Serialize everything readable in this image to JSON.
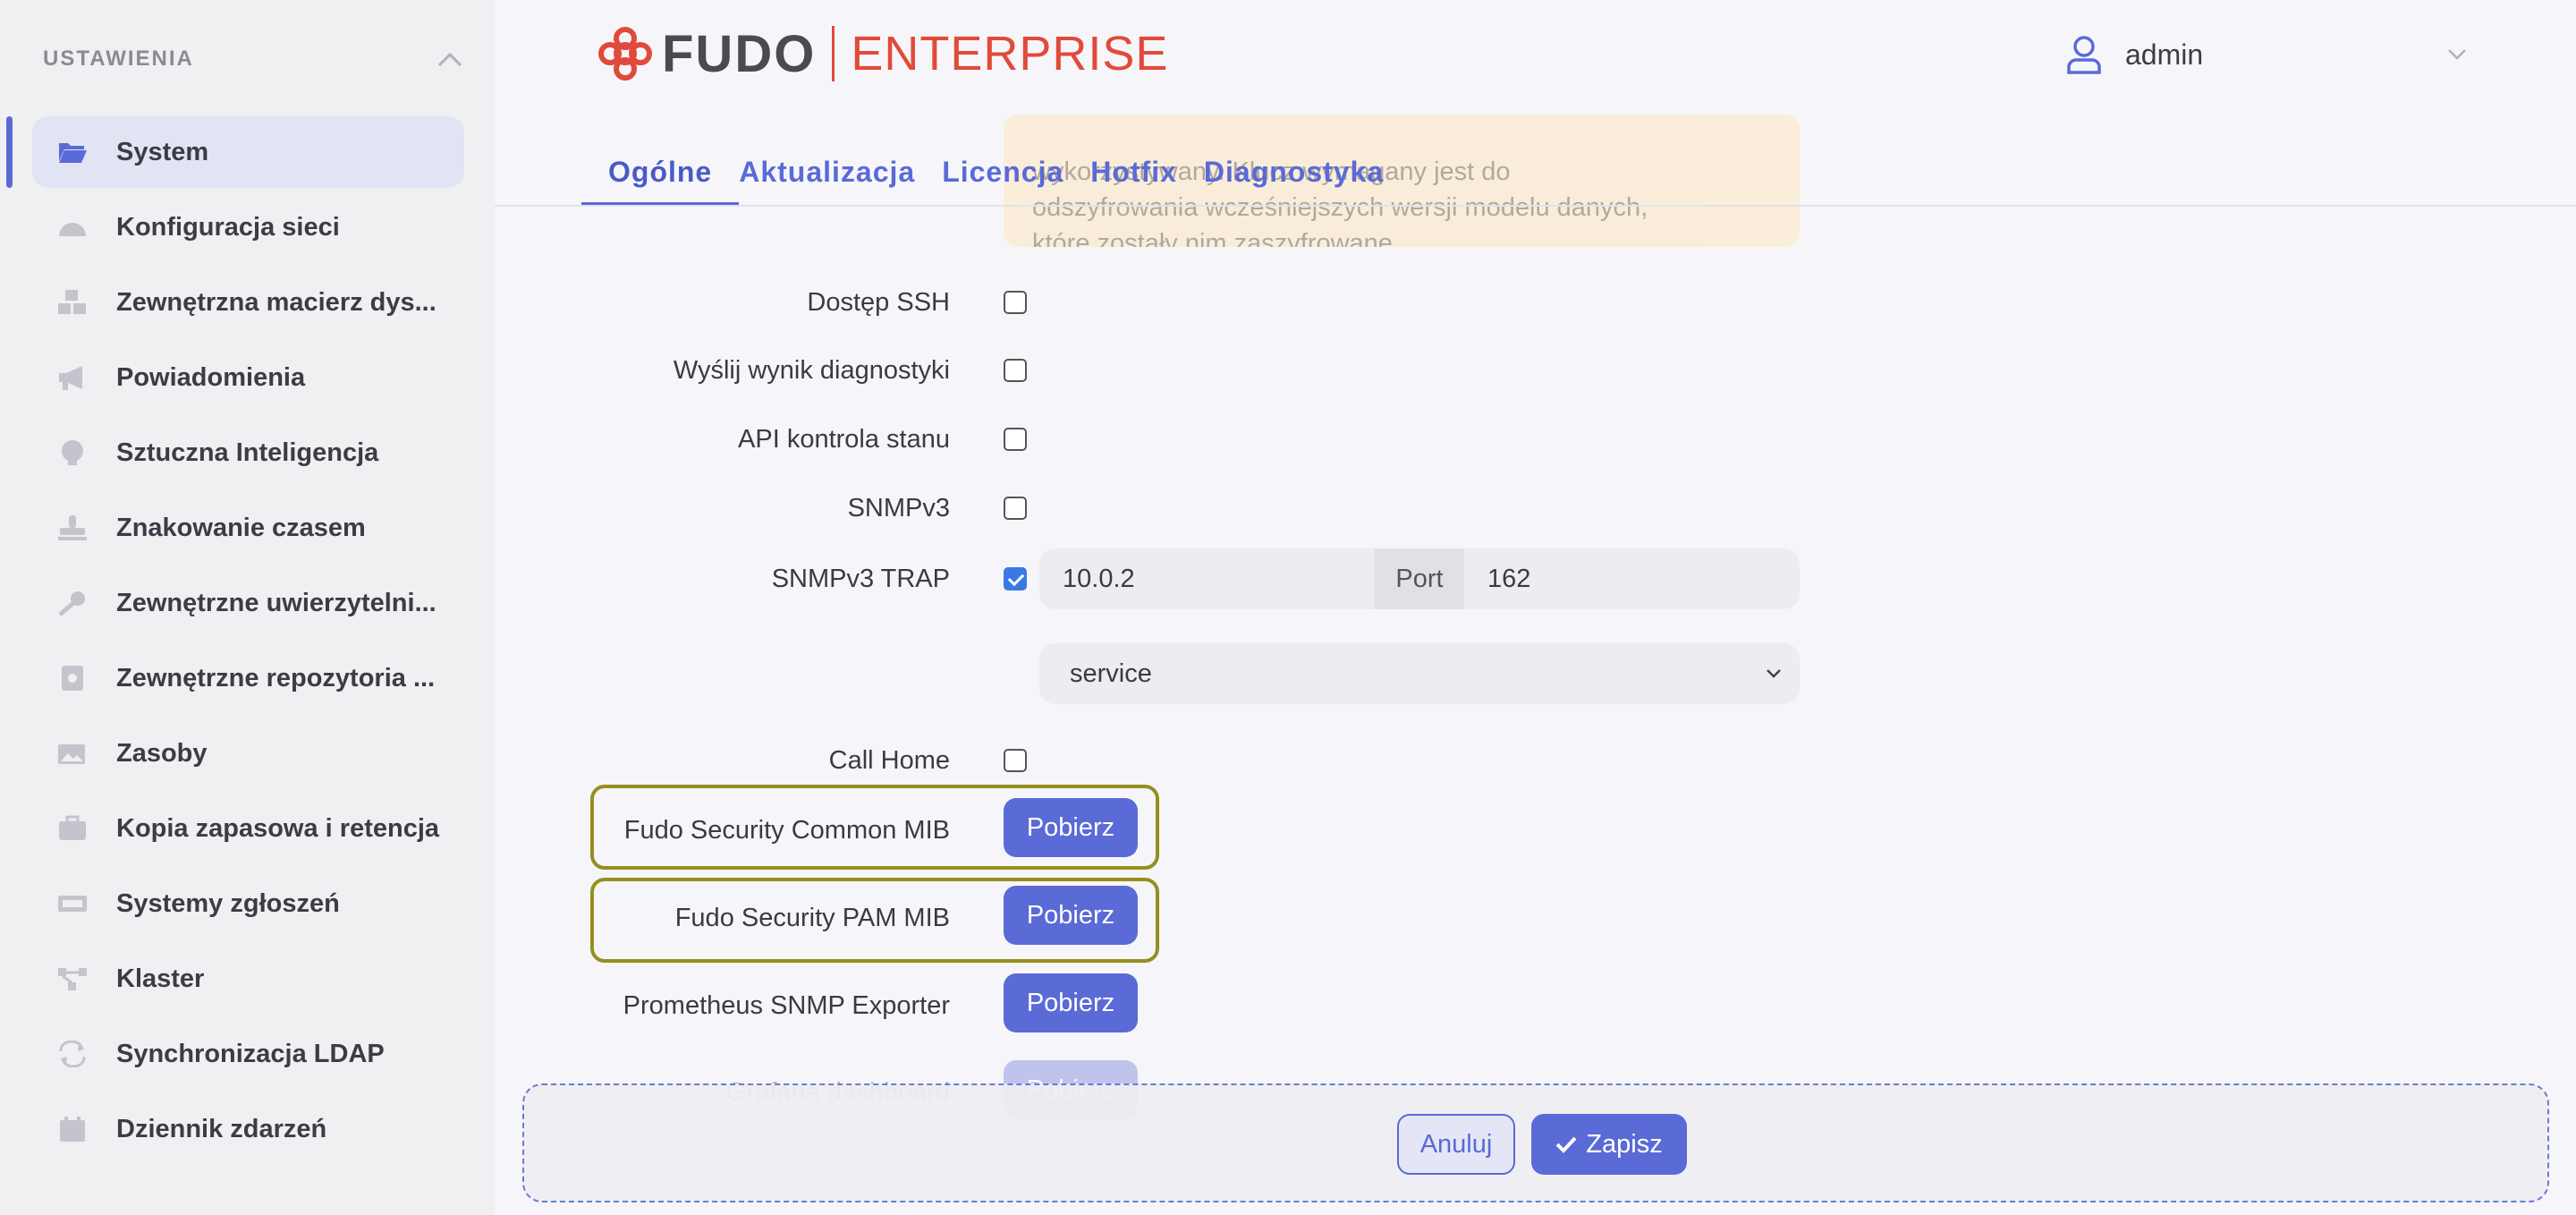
{
  "sidebar": {
    "title": "USTAWIENIA",
    "items": [
      {
        "label": "System",
        "icon": "folder-open-icon",
        "active": true
      },
      {
        "label": "Konfiguracja sieci",
        "icon": "network-icon"
      },
      {
        "label": "Zewnętrzna macierz dys...",
        "icon": "storage-boxes-icon"
      },
      {
        "label": "Powiadomienia",
        "icon": "megaphone-icon"
      },
      {
        "label": "Sztuczna Inteligencja",
        "icon": "brain-icon"
      },
      {
        "label": "Znakowanie czasem",
        "icon": "stamp-icon"
      },
      {
        "label": "Zewnętrzne uwierzytelni...",
        "icon": "key-icon"
      },
      {
        "label": "Zewnętrzne repozytoria ...",
        "icon": "vault-icon"
      },
      {
        "label": "Zasoby",
        "icon": "images-icon"
      },
      {
        "label": "Kopia zapasowa i retencja",
        "icon": "briefcase-icon"
      },
      {
        "label": "Systemy zgłoszeń",
        "icon": "ticket-icon"
      },
      {
        "label": "Klaster",
        "icon": "cluster-icon"
      },
      {
        "label": "Synchronizacja LDAP",
        "icon": "sync-icon"
      },
      {
        "label": "Dziennik zdarzeń",
        "icon": "calendar-icon"
      }
    ]
  },
  "header": {
    "logo_fudo": "FUDO",
    "logo_enterprise": "ENTERPRISE",
    "user": "admin"
  },
  "tabs": [
    "Ogólne",
    "Aktualizacja",
    "Licencja",
    "Hotfix",
    "Diagnostyka"
  ],
  "warning": {
    "line1": "wykorzystywany. Klucz wymagany jest do",
    "line2": "odszyfrowania wcześniejszych wersji modelu danych,",
    "line3": "które zostały nim zaszyfrowane."
  },
  "form": {
    "ssh_label": "Dostęp SSH",
    "diag_label": "Wyślij wynik diagnostyki",
    "api_label": "API kontrola stanu",
    "snmpv3_label": "SNMPv3",
    "trap_label": "SNMPv3 TRAP",
    "trap_ip": "10.0.2",
    "trap_port_label": "Port",
    "trap_port": "162",
    "trap_user": "service",
    "callhome_label": "Call Home",
    "common_mib_label": "Fudo Security Common MIB",
    "pam_mib_label": "Fudo Security PAM MIB",
    "prometheus_label": "Prometheus SNMP Exporter",
    "grafana_label": "Grafana dashboard",
    "download": "Pobierz"
  },
  "footer": {
    "cancel": "Anuluj",
    "save": "Zapisz"
  },
  "colors": {
    "accent": "#5a6ad6",
    "brand_red": "#e14a3a",
    "highlight": "#958f1e",
    "warning_bg": "#fde6c0"
  }
}
